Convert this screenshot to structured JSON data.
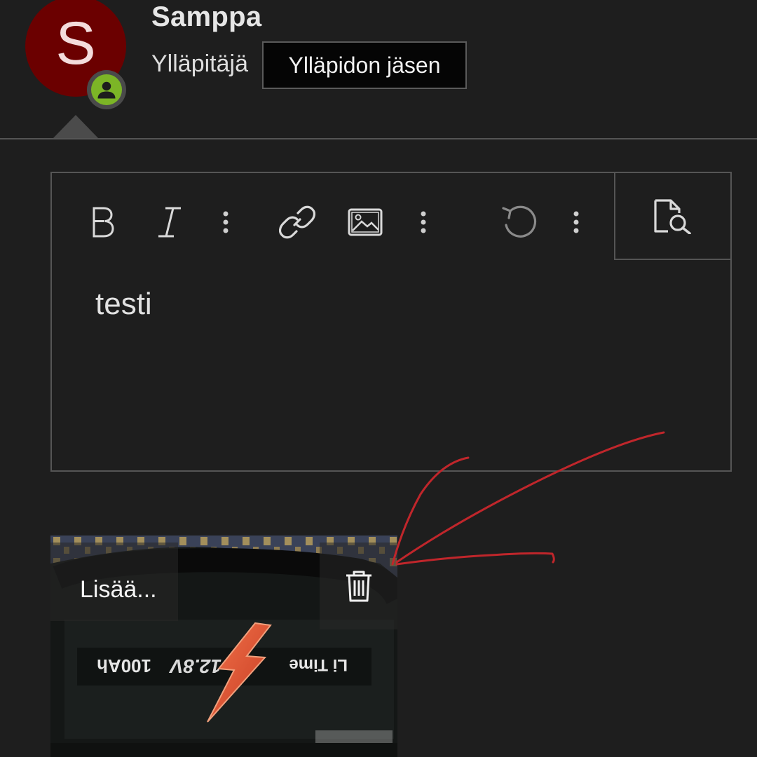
{
  "user": {
    "avatar_letter": "S",
    "name": "Samppa",
    "role": "Ylläpitäjä",
    "badge": "Ylläpidon jäsen",
    "status_icon": "user-icon",
    "status_color": "#7cb526",
    "avatar_color": "#6b0000"
  },
  "editor": {
    "toolbar": [
      {
        "name": "bold",
        "icon": "bold-icon"
      },
      {
        "name": "italic",
        "icon": "italic-icon"
      },
      {
        "name": "more-text-options",
        "icon": "vertical-dots-icon"
      },
      {
        "name": "insert-link",
        "icon": "link-icon"
      },
      {
        "name": "insert-image",
        "icon": "image-icon"
      },
      {
        "name": "more-insert-options",
        "icon": "vertical-dots-icon"
      },
      {
        "name": "undo",
        "icon": "undo-icon"
      },
      {
        "name": "more-options",
        "icon": "vertical-dots-icon"
      },
      {
        "name": "preview",
        "icon": "preview-icon"
      }
    ],
    "content": "testi"
  },
  "attachment": {
    "more_label": "Lisää...",
    "delete_icon": "trash-icon",
    "thumbnail_text": "Li Time 12.8V 100Ah"
  },
  "annotation": {
    "type": "hand-drawn arrow",
    "color": "#c0262b"
  }
}
